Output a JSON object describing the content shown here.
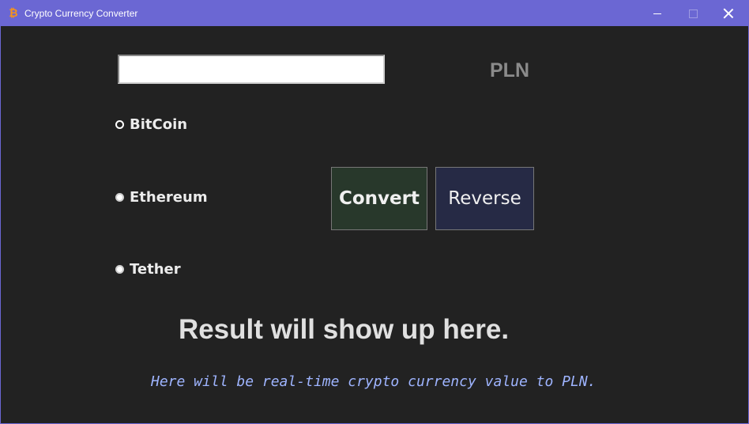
{
  "window": {
    "title": "Crypto Currency Converter",
    "app_icon": "bitcoin-icon",
    "app_icon_glyph": "₿",
    "controls": [
      "minimize-icon",
      "maximize-icon",
      "close-icon"
    ]
  },
  "converter": {
    "amount_value": "",
    "target_currency": "PLN",
    "options": [
      {
        "label": "BitCoin",
        "selected": false
      },
      {
        "label": "Ethereum",
        "selected": true
      },
      {
        "label": "Tether",
        "selected": true
      }
    ],
    "convert_label": "Convert",
    "reverse_label": "Reverse"
  },
  "result": {
    "text": "Result will show up here.",
    "rate_text": "Here will be real-time crypto currency value to PLN."
  },
  "colors": {
    "titlebar": "#6b67d3",
    "background": "#222222",
    "convert_button": "#28382b",
    "reverse_button": "#262a45",
    "rate_text": "#9eb4ff"
  }
}
